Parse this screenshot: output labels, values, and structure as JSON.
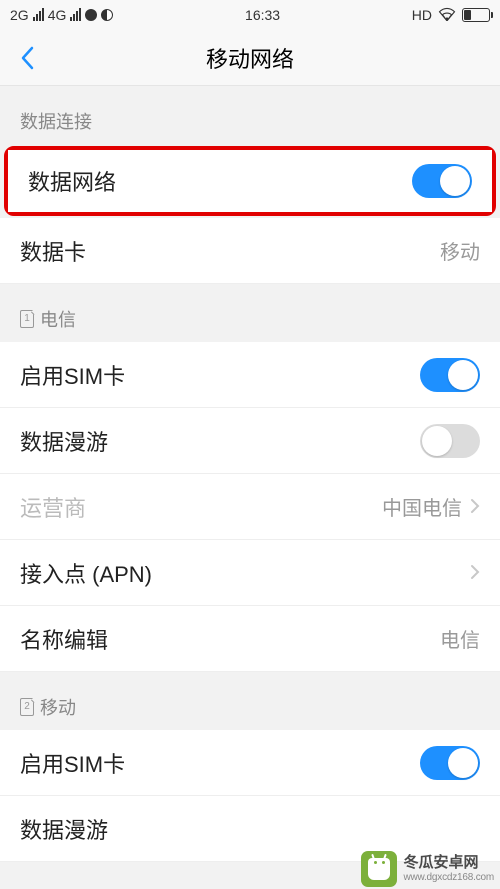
{
  "status_bar": {
    "network1": "2G",
    "network2": "4G",
    "time": "16:33",
    "hd": "HD"
  },
  "header": {
    "title": "移动网络"
  },
  "sections": {
    "data_connection": {
      "header": "数据连接",
      "data_network_label": "数据网络",
      "data_card_label": "数据卡",
      "data_card_value": "移动"
    },
    "telecom": {
      "header": "电信",
      "sim_num": "1",
      "enable_sim_label": "启用SIM卡",
      "roaming_label": "数据漫游",
      "carrier_label": "运营商",
      "carrier_value": "中国电信",
      "apn_label": "接入点 (APN)",
      "name_edit_label": "名称编辑",
      "name_edit_value": "电信"
    },
    "mobile": {
      "header": "移动",
      "sim_num": "2",
      "enable_sim_label": "启用SIM卡",
      "roaming_label": "数据漫游"
    }
  },
  "watermark": {
    "name": "冬瓜安卓网",
    "url": "www.dgxcdz168.com"
  }
}
